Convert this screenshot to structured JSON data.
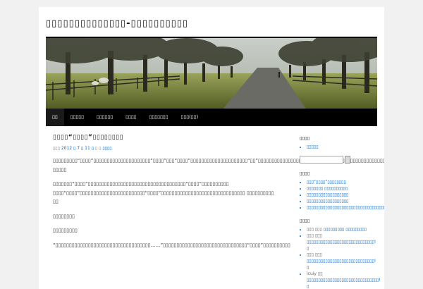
{
  "site": {
    "title": "▯▯▯▯▯▯▯▯▯▯▯▯▯▯-▯▯▯▯▯▯▯▯▯▯"
  },
  "nav": {
    "items": [
      {
        "label": "▯▯"
      },
      {
        "label": "▯▯▯▯▯"
      },
      {
        "label": "▯▯▯▯▯▯"
      },
      {
        "label": "▯▯▯▯"
      },
      {
        "label": "▯▯▯▯▯▯▯"
      },
      {
        "label": "▯▯▯(▯▯)"
      }
    ]
  },
  "post": {
    "title": "▯▯▯▯“▯▯▯▯”▯▯▯▯▯▯▯▯",
    "meta_prefix": "▯▯▯",
    "meta_date": "2012 ▯ 7 ▯ 11 ▯",
    "meta_by": "▯ ▯",
    "meta_author": "▯▯▯▯",
    "paragraphs": [
      "▯▯▯▯▯▯▯▯▯“▯▯▯▯”▯▯▯▯▯▯▯▯▯▯▯▯▯▯▯▯▯▯▯▯▯“▯▯▯▯”▯▯▯“▯▯▯▯”▯▯▯▯▯▯▯▯▯▯▯▯▯▯▯▯▯▯▯▯▯“▯▯”▯▯▯▯▯▯▯▯▯▯▯▯▯▯▯▯▯▯▯▯▯▯▯“▯▯▯▯”▯▯▯▯▯▯▯▯▯▯▯▯▯▯▯▯▯▯▯▯▯▯▯▯▯▯▯▯▯▯▯ ▯▯▯▯▯",
      "▯▯▯▯▯▯▯“▯▯▯▯”▯▯▯▯▯▯▯▯▯▯▯▯▯▯▯▯▯▯▯▯▯▯▯▯▯▯▯▯▯▯▯▯▯▯▯▯“▯▯▯▯”▯▯▯▯▯▯▯▯▯▯ ▯▯▯▯“▯▯▯▯”▯▯▯▯▯▯▯▯▯▯▯▯▯▯▯▯▯▯▯▯▯▯▯▯“▯▯▯▯”▯▯▯▯▯▯▯▯▯▯▯▯▯▯▯▯▯▯▯▯▯▯▯▯▯▯▯▯▯▯▯ ▯▯▯▯▯▯▯▯▯▯ ▯▯",
      "▯▯▯▯▯▯▯▯",
      "▯▯▯▯▯▯▯▯▯",
      "“▯▯▯▯▯▯▯▯▯▯▯▯▯▯▯▯▯▯▯▯▯▯▯▯▯▯▯▯▯▯▯▯▯▯▯……”▯▯▯▯▯▯▯▯▯▯▯▯▯▯▯▯▯▯▯▯▯▯▯▯▯▯▯▯▯▯▯“▯▯▯▯”▯▯▯▯▯▯▯▯▯▯"
    ]
  },
  "sidebar": {
    "widgets": [
      {
        "title": "▯▯▯▯",
        "items": [
          {
            "text": "▯▯▯▯▯"
          }
        ],
        "search": true
      },
      {
        "title": "▯▯▯▯",
        "items": [
          {
            "text": "▯▯▯“▯▯▯▯”▯▯▯▯▯▯▯▯"
          },
          {
            "text": "▯▯▯▯▯▯▯ ▯▯▯▯▯▯▯▯▯▯"
          },
          {
            "text": "▯▯▯▯▯▯▯▯▯▯▯▯▯▯▯▯▯▯"
          },
          {
            "text": "▯▯▯▯▯▯▯▯▯▯▯▯▯▯▯▯▯▯"
          },
          {
            "text": "▯▯▯▯▯▯▯▯▯▯▯▯▯▯▯▯▯▯▯▯▯▯▯▯▯▯▯▯▯▯▯▯▯▯!"
          }
        ]
      },
      {
        "title": "▯▯▯▯",
        "items": [
          {
            "who": "▯▯▯ ▯▯▯",
            "text": "▯▯▯▯▯▯▯▯▯ ▯▯▯▯▯▯▯▯▯"
          },
          {
            "who": "▯▯▯ ▯▯▯",
            "text": "▯▯▯▯▯▯▯▯▯▯▯▯▯▯▯▯▯▯▯▯▯▯▯▯▯▯▯▯▯!▯"
          },
          {
            "who": "▯▯▯ ▯▯▯",
            "text": "▯▯▯▯▯▯▯▯▯▯▯▯▯▯▯▯▯▯▯▯▯▯▯▯▯▯▯▯▯!▯"
          },
          {
            "who": "lcuiy ▯▯",
            "text": "▯▯▯▯▯▯▯▯▯▯▯▯▯▯▯▯▯▯▯▯▯▯▯▯▯▯▯▯▯▯▯!▯"
          }
        ]
      }
    ]
  }
}
